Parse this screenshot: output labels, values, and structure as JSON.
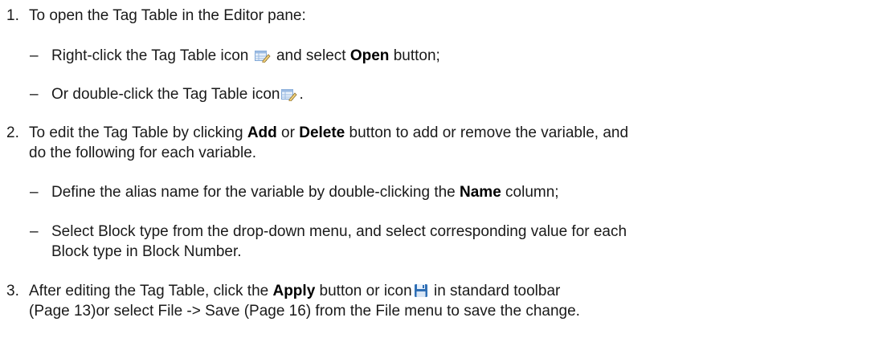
{
  "step1": {
    "number": "1.",
    "text": "To open the Tag Table in the Editor pane:",
    "sub1": {
      "dash": "–",
      "pre": "Right-click the Tag Table icon",
      "mid": "and select",
      "bold": "Open",
      "post": "button;"
    },
    "sub2": {
      "dash": "–",
      "pre": "Or double-click the Tag Table icon",
      "post": "."
    }
  },
  "step2": {
    "number": "2.",
    "line1_pre": "To edit the Tag Table by clicking",
    "add": "Add",
    "or": "or",
    "delete": "Delete",
    "line1_post": "button to add or remove the variable, and",
    "line2": "do the following for each variable.",
    "sub1": {
      "dash": "–",
      "pre": "Define the alias name for the variable by double-clicking the",
      "bold": "Name",
      "post": "column;"
    },
    "sub2": {
      "dash": "–",
      "line1": "Select Block type from the drop-down menu, and select corresponding value for each",
      "line2": "Block type in Block Number."
    }
  },
  "step3": {
    "number": "3.",
    "line1_pre": "After editing the Tag Table, click the",
    "apply": "Apply",
    "line1_mid": "button or icon",
    "line1_post": "in standard toolbar",
    "line2": "(Page 13)or select File -> Save (Page 16) from the File menu to save the change."
  },
  "icons": {
    "tag_table": "tag-table-icon",
    "save": "save-icon",
    "save_color": "#2f6fb5"
  }
}
